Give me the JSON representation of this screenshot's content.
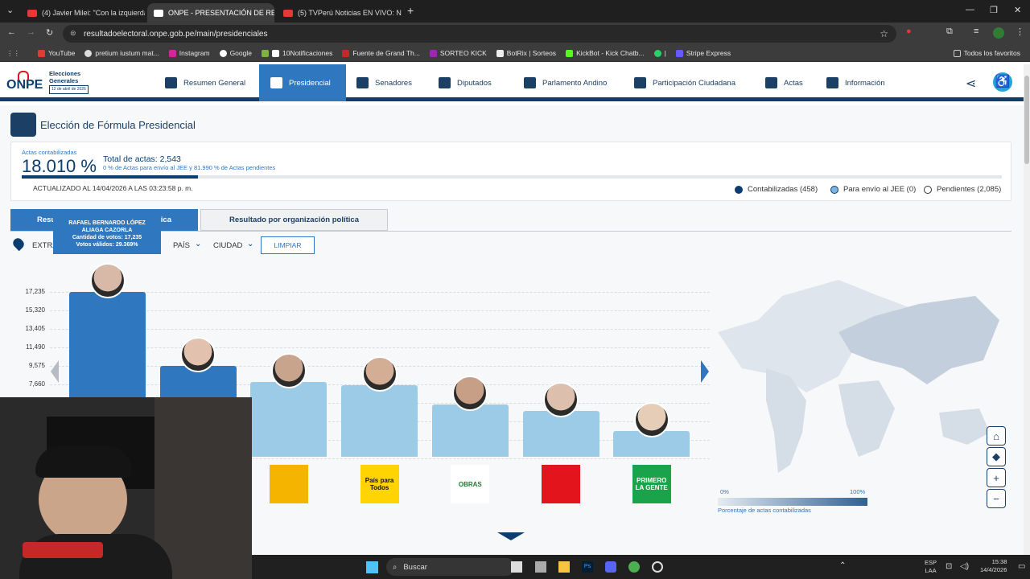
{
  "browser": {
    "tabs": [
      {
        "label": "(4) Javier Milei: \"Con la izquierda",
        "color": "#e53935"
      },
      {
        "label": "ONPE - PRESENTACIÓN DE RES",
        "color": "#ffffff"
      },
      {
        "label": "(5) TVPerú Noticias EN VIVO: N",
        "color": "#e53935"
      }
    ],
    "url": "resultadoelectoral.onpe.gob.pe/main/presidenciales",
    "bookmarks": [
      "YouTube",
      "pretium iustum mat...",
      "Instagram",
      "Google",
      "10Notificaciones",
      "Fuente de Grand Th...",
      "SORTEO KICK",
      "BotRix | Sorteos",
      "KickBot - Kick Chatb...",
      "|",
      "Stripe Express"
    ],
    "all_favorites": "Todos los favoritos"
  },
  "site": {
    "logo_text": "ONPE",
    "logo_sub1": "Elecciones",
    "logo_sub2": "Generales",
    "logo_date": "12 de abril de 2026",
    "nav": [
      "Resumen General",
      "Presidencial",
      "Senadores",
      "Diputados",
      "Parlamento Andino",
      "Participación Ciudadana",
      "Actas",
      "Información"
    ],
    "page_title": "Elección de Fórmula Presidencial"
  },
  "summary": {
    "actas_label": "Actas contabilizadas",
    "percent": "18.010 %",
    "total_label": "Total de actas: 2,543",
    "sub_text": "0 % de Actas para envío al JEE y 81.990 % de Actas pendientes",
    "progress": 0.1801,
    "updated": "ACTUALIZADO AL 14/04/2026 A LAS 03:23:58 p. m.",
    "legend": [
      "Contabilizadas (458)",
      "Para envío al JEE (0)",
      "Pendientes (2,085)"
    ]
  },
  "tabs": {
    "tab1_start": "Resul",
    "tab1_end": "ica",
    "tab2": "Resultado por organización política"
  },
  "filters": {
    "location_start": "EXTRA",
    "pais": "PAÍS",
    "ciudad": "CIUDAD",
    "clear": "LIMPIAR"
  },
  "tooltip": {
    "name_line1": "RAFAEL BERNARDO LÓPEZ",
    "name_line2": "ALIAGA CAZORLA",
    "votes": "Cantidad de votos: 17,235",
    "valid": "Votos válidos: 29.369%"
  },
  "chart_data": {
    "type": "bar",
    "yticks": [
      "17,235",
      "15,320",
      "13,405",
      "11,490",
      "9,575",
      "7,660"
    ],
    "ylim": [
      0,
      17235
    ],
    "values": [
      17235,
      9575,
      7900,
      7600,
      5600,
      4900,
      2800
    ],
    "colors": [
      "#2f78bf",
      "#2f78bf",
      "#9ccbe8",
      "#9ccbe8",
      "#9ccbe8",
      "#9ccbe8",
      "#9ccbe8"
    ]
  },
  "party_logos": [
    {
      "text": "",
      "bg": "#f5b400",
      "fg": "#d71920"
    },
    {
      "text": "País para Todos",
      "bg": "#ffd400",
      "fg": "#111"
    },
    {
      "text": "OBRAS",
      "bg": "#ffffff",
      "fg": "#1e7a2e"
    },
    {
      "text": "",
      "bg": "#e3141b",
      "fg": "#ffffff"
    },
    {
      "text": "PRIMERO LA GENTE",
      "bg": "#1aa34a",
      "fg": "#ffffff"
    }
  ],
  "map": {
    "min": "0%",
    "max": "100%",
    "caption": "Porcentaje de actas contabilizadas"
  },
  "taskbar": {
    "search": "Buscar",
    "lang1": "ESP",
    "lang2": "LAA",
    "time": "15:38",
    "date": "14/4/2026"
  }
}
